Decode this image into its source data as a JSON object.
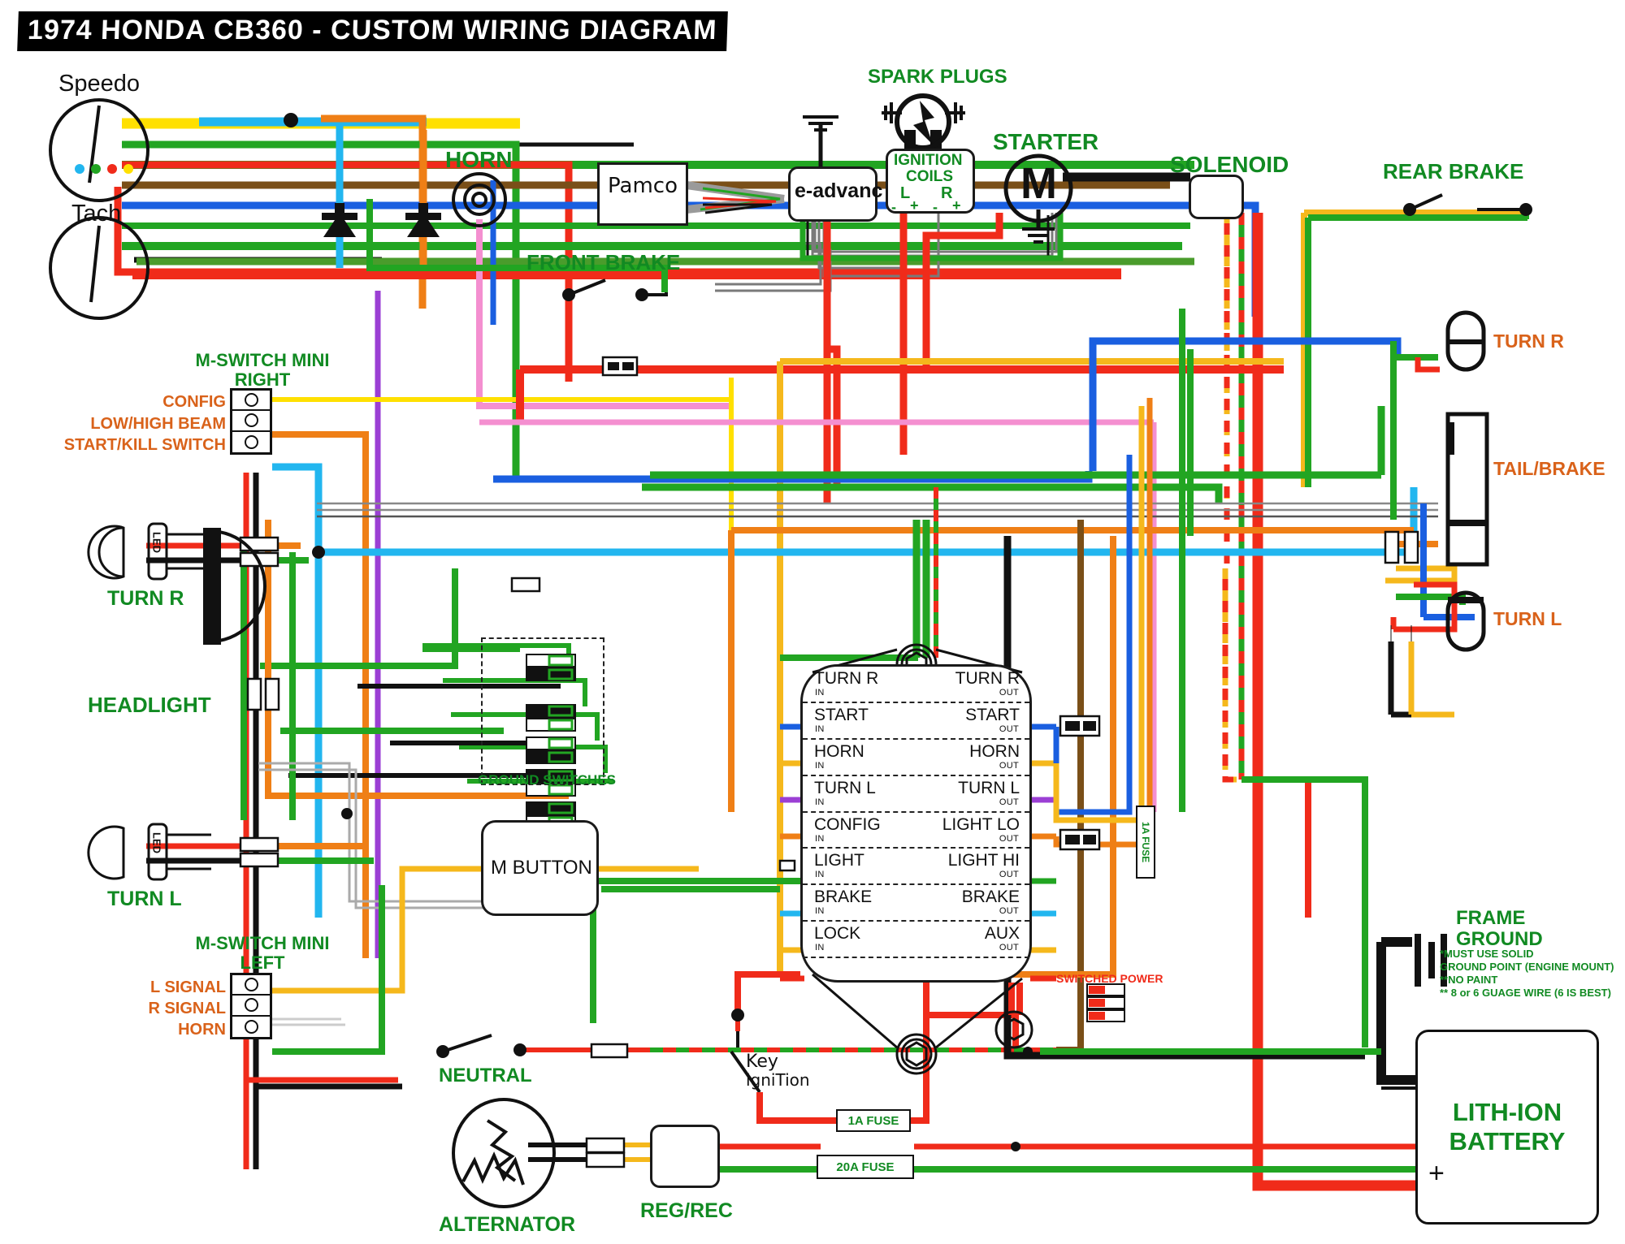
{
  "title": "1974 HONDA CB360   - CUSTOM WIRING DIAGRAM",
  "labels": {
    "speedo": "Speedo",
    "tach": "Tach",
    "horn": "HORN",
    "front_brake": "FRONT BRAKE",
    "rear_brake": "REAR BRAKE",
    "spark_plugs": "SPARK PLUGS",
    "ignition_coils_l1": "IGNITION",
    "ignition_coils_l2": "COILS",
    "coil_L": "L",
    "coil_R": "R",
    "coil_minus_l": "-",
    "coil_plus_l": "+",
    "coil_minus_r": "-",
    "coil_plus_r": "+",
    "starter": "STARTER",
    "starter_glyph": "M",
    "solenoid": "SOLENOID",
    "pamco": "Pamco",
    "eadvance": "e-advanc",
    "headlight": "HEADLIGHT",
    "turn_r_left": "TURN R",
    "turn_l_left": "TURN L",
    "turn_r_right": "TURN R",
    "turn_l_right": "TURN L",
    "tail_brake": "TAIL/BRAKE",
    "neutral": "NEUTRAL",
    "alternator": "ALTERNATOR",
    "reg_rec": "REG/REC",
    "m_button": "M BUTTON",
    "ground_switches": "GROUND SWITCHES",
    "key_ignition_l1": "Key",
    "key_ignition_l2": "igniTion",
    "switched_power": "SWITCHED POWER",
    "led": "LED"
  },
  "switch_right": {
    "title_line1": "M-SWITCH MINI",
    "title_line2": "RIGHT",
    "rows": [
      "CONFIG",
      "LOW/HIGH BEAM",
      "START/KILL SWITCH"
    ]
  },
  "switch_left": {
    "title_line1": "M-SWITCH MINI",
    "title_line2": "LEFT",
    "rows": [
      "L SIGNAL",
      "R SIGNAL",
      "HORN"
    ]
  },
  "munit": {
    "rows": [
      {
        "in": "TURN R",
        "in_sub": "IN",
        "out": "TURN R",
        "out_sub": "OUT"
      },
      {
        "in": "START",
        "in_sub": "IN",
        "out": "START",
        "out_sub": "OUT"
      },
      {
        "in": "HORN",
        "in_sub": "IN",
        "out": "HORN",
        "out_sub": "OUT"
      },
      {
        "in": "TURN L",
        "in_sub": "IN",
        "out": "TURN L",
        "out_sub": "OUT"
      },
      {
        "in": "CONFIG",
        "in_sub": "IN",
        "out": "LIGHT LO",
        "out_sub": "OUT"
      },
      {
        "in": "LIGHT",
        "in_sub": "IN",
        "out": "LIGHT HI",
        "out_sub": "OUT"
      },
      {
        "in": "BRAKE",
        "in_sub": "IN",
        "out": "BRAKE",
        "out_sub": "OUT"
      },
      {
        "in": "LOCK",
        "in_sub": "IN",
        "out": "AUX",
        "out_sub": "OUT"
      }
    ]
  },
  "fuses": {
    "fuse_1a_main": "1A FUSE",
    "fuse_20a": "20A FUSE",
    "fuse_1a_vertical": "1A FUSE"
  },
  "ground_note": {
    "line1": "FRAME",
    "line2": "GROUND",
    "note1": "*MUST USE SOLID",
    "note2": "GROUND POINT (ENGINE MOUNT)",
    "note3": "**NO PAINT",
    "note4": "** 8 or 6 GUAGE WIRE (6 IS BEST)"
  },
  "battery": {
    "line1": "LITH-ION",
    "line2": "BATTERY",
    "plus": "+"
  },
  "colors": {
    "green": "#22a522",
    "dark_green": "#118a22",
    "red": "#f02b1a",
    "orange": "#ef7f16",
    "light_blue": "#22b6ef",
    "blue": "#1a5fe0",
    "yellow": "#ffe000",
    "amber": "#f5b81c",
    "brown": "#7a4f18",
    "black": "#111111",
    "purple": "#9b3fd4",
    "pink": "#f48fd0",
    "label_orange": "#d9621a"
  }
}
